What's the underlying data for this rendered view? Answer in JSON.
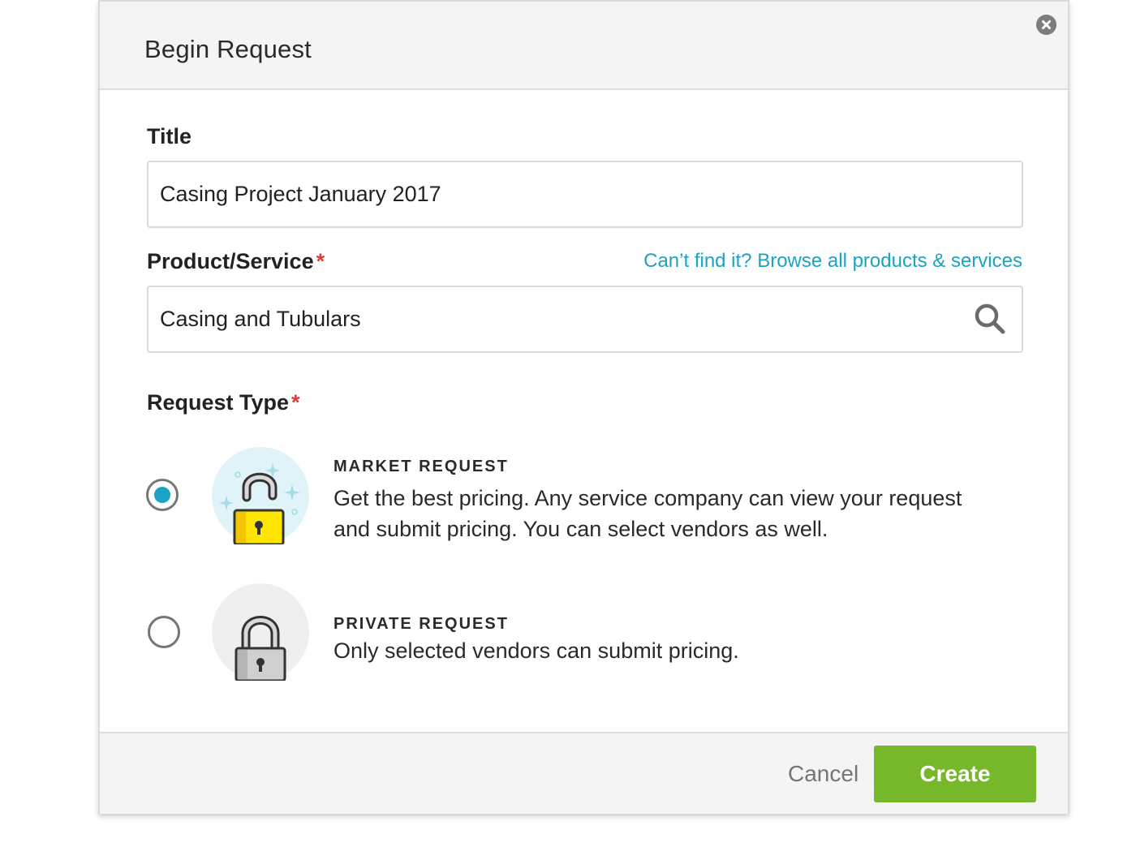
{
  "dialog": {
    "title": "Begin Request"
  },
  "title_field": {
    "label": "Title",
    "value": "Casing Project January 2017"
  },
  "product_field": {
    "label": "Product/Service",
    "required_mark": "*",
    "browse_link": "Can’t find it? Browse all products & services",
    "value": "Casing and Tubulars"
  },
  "request_type": {
    "label": "Request Type",
    "required_mark": "*",
    "options": [
      {
        "title": "MARKET REQUEST",
        "description": "Get the best pricing. Any service company can view your request and submit pricing. You can select vendors as well.",
        "selected": true,
        "icon": "unlocked-padlock-icon"
      },
      {
        "title": "PRIVATE REQUEST",
        "description": "Only selected vendors can submit pricing.",
        "selected": false,
        "icon": "locked-padlock-icon"
      }
    ]
  },
  "footer": {
    "cancel_label": "Cancel",
    "create_label": "Create"
  },
  "colors": {
    "accent": "#1aa3c4",
    "primary_button": "#76b82a",
    "required": "#e53935"
  }
}
